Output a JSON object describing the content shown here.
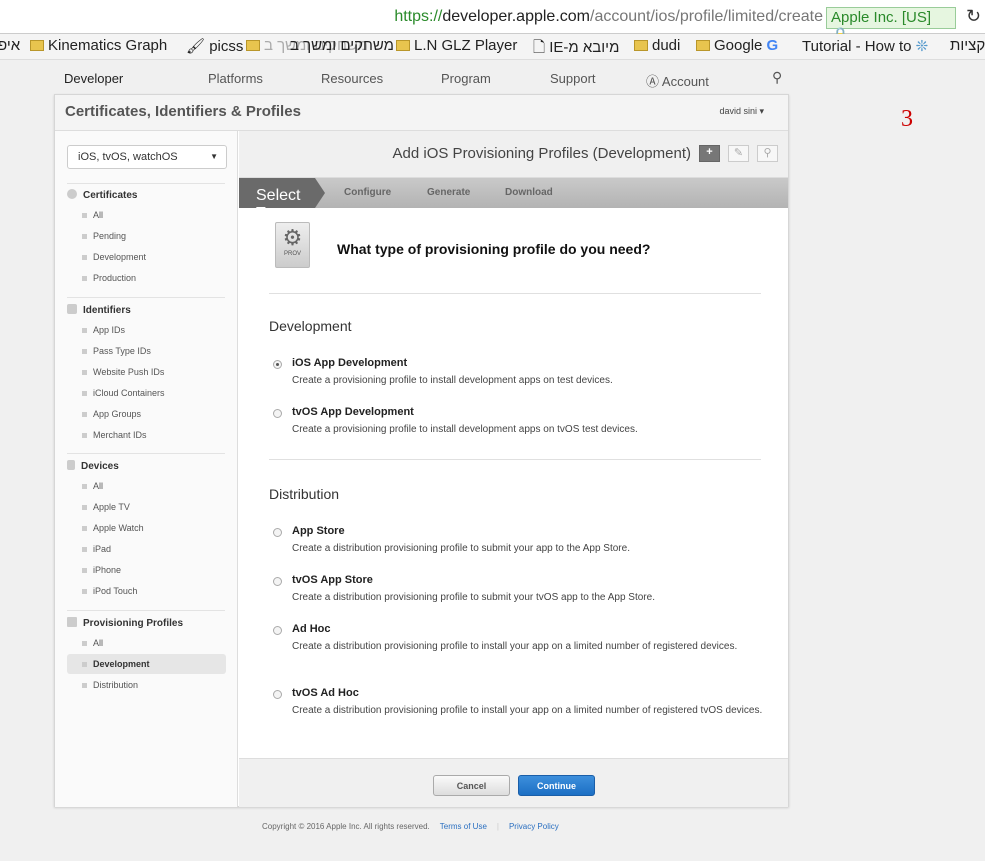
{
  "browser": {
    "url_scheme": "https://",
    "url_domain": "developer.apple.com",
    "url_path": "/account/ios/profile/limited/create",
    "ev_label": "Apple Inc. [US]",
    "bookmarks": [
      "איפ",
      "Kinematics Graph",
      "picss",
      "משחקים ומשך ב",
      "L.N GLZ Player",
      "IE-מיובא מ",
      "dudi",
      "Google",
      "Tutorial - How to",
      "קציות"
    ]
  },
  "nav": {
    "brand": "Developer",
    "items": [
      "Platforms",
      "Resources",
      "Program",
      "Support",
      "Account"
    ]
  },
  "header": {
    "title": "Certificates, Identifiers & Profiles",
    "user": "david sini ▾"
  },
  "sidebar": {
    "platform": "iOS, tvOS, watchOS",
    "sections": [
      {
        "label": "Certificates",
        "items": [
          "All",
          "Pending",
          "Development",
          "Production"
        ]
      },
      {
        "label": "Identifiers",
        "items": [
          "App IDs",
          "Pass Type IDs",
          "Website Push IDs",
          "iCloud Containers",
          "App Groups",
          "Merchant IDs"
        ]
      },
      {
        "label": "Devices",
        "items": [
          "All",
          "Apple TV",
          "Apple Watch",
          "iPad",
          "iPhone",
          "iPod Touch"
        ]
      },
      {
        "label": "Provisioning Profiles",
        "items": [
          "All",
          "Development",
          "Distribution"
        ]
      }
    ],
    "selected": "Development"
  },
  "content": {
    "title": "Add iOS Provisioning Profiles (Development)",
    "steps": [
      "Select Type",
      "Configure",
      "Generate",
      "Download"
    ],
    "icon_label": "PROV",
    "question": "What type of provisioning profile do you need?",
    "groups": [
      {
        "heading": "Development",
        "options": [
          {
            "title": "iOS App Development",
            "desc": "Create a provisioning profile to install development apps on test devices.",
            "selected": true
          },
          {
            "title": "tvOS App Development",
            "desc": "Create a provisioning profile to install development apps on tvOS test devices.",
            "selected": false
          }
        ]
      },
      {
        "heading": "Distribution",
        "options": [
          {
            "title": "App Store",
            "desc": "Create a distribution provisioning profile to submit your app to the App Store.",
            "selected": false
          },
          {
            "title": "tvOS App Store",
            "desc": "Create a distribution provisioning profile to submit your tvOS app to the App Store.",
            "selected": false
          },
          {
            "title": "Ad Hoc",
            "desc": "Create a distribution provisioning profile to install your app on a limited number of registered devices.",
            "selected": false
          },
          {
            "title": "tvOS Ad Hoc",
            "desc": "Create a distribution provisioning profile to install your app on a limited number of registered tvOS devices.",
            "selected": false
          }
        ]
      }
    ],
    "cancel": "Cancel",
    "continue": "Continue"
  },
  "footer": {
    "copyright": "Copyright © 2016 Apple Inc. All rights reserved.",
    "terms": "Terms of Use",
    "sep": "|",
    "privacy": "Privacy Policy"
  },
  "annotation": "3"
}
